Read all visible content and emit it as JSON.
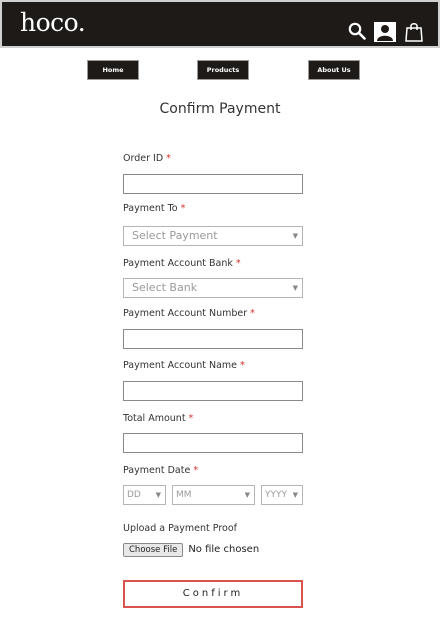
{
  "header": {
    "logo": "hoco.",
    "icons": [
      "search-icon",
      "user-icon",
      "shopping-bag-icon"
    ]
  },
  "nav": {
    "items": [
      {
        "label": "Home"
      },
      {
        "label": "Products"
      },
      {
        "label": "About Us"
      }
    ]
  },
  "page": {
    "title": "Confirm Payment"
  },
  "form": {
    "order_id": {
      "label": "Order ID",
      "required": "*",
      "value": ""
    },
    "payment_to": {
      "label": "Payment To",
      "required": "*",
      "selected": "Select Payment"
    },
    "account_bank": {
      "label": "Payment Account Bank",
      "required": "*",
      "selected": "Select Bank"
    },
    "account_number": {
      "label": "Payment Account Number",
      "required": "*",
      "value": ""
    },
    "account_name": {
      "label": "Payment Account Name",
      "required": "*",
      "value": ""
    },
    "total_amount": {
      "label": "Total Amount",
      "required": "*",
      "value": ""
    },
    "payment_date": {
      "label": "Payment Date",
      "required": "*",
      "day": "DD",
      "month": "MM",
      "year": "YYYY"
    },
    "upload": {
      "label": "Upload a Payment Proof",
      "button": "Choose File",
      "status": "No file chosen"
    },
    "submit": "Confirm"
  },
  "colors": {
    "header_bg": "#1e1a17",
    "required": "#d9302c",
    "confirm_border": "#d9534f"
  }
}
